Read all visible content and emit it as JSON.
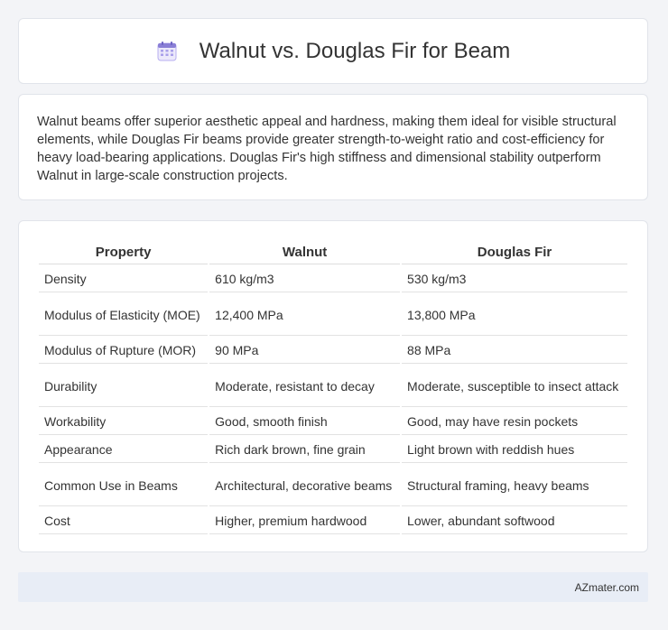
{
  "header": {
    "title": "Walnut vs. Douglas Fir for Beam",
    "icon": "calendar-icon"
  },
  "summary": {
    "text": "Walnut beams offer superior aesthetic appeal and hardness, making them ideal for visible structural elements, while Douglas Fir beams provide greater strength-to-weight ratio and cost-efficiency for heavy load-bearing applications. Douglas Fir's high stiffness and dimensional stability outperform Walnut in large-scale construction projects."
  },
  "table": {
    "headers": [
      "Property",
      "Walnut",
      "Douglas Fir"
    ],
    "rows": [
      [
        "Density",
        "610 kg/m3",
        "530 kg/m3"
      ],
      [
        "Modulus of Elasticity (MOE)",
        "12,400 MPa",
        "13,800 MPa"
      ],
      [
        "Modulus of Rupture (MOR)",
        "90 MPa",
        "88 MPa"
      ],
      [
        "Durability",
        "Moderate, resistant to decay",
        "Moderate, susceptible to insect attack"
      ],
      [
        "Workability",
        "Good, smooth finish",
        "Good, may have resin pockets"
      ],
      [
        "Appearance",
        "Rich dark brown, fine grain",
        "Light brown with reddish hues"
      ],
      [
        "Common Use in Beams",
        "Architectural, decorative beams",
        "Structural framing, heavy beams"
      ],
      [
        "Cost",
        "Higher, premium hardwood",
        "Lower, abundant softwood"
      ]
    ]
  },
  "footer": {
    "brand": "AZmater.com"
  },
  "colors": {
    "background": "#f3f4f7",
    "footer_bg": "#e8edf6",
    "icon_accent": "#8a7fd6"
  }
}
